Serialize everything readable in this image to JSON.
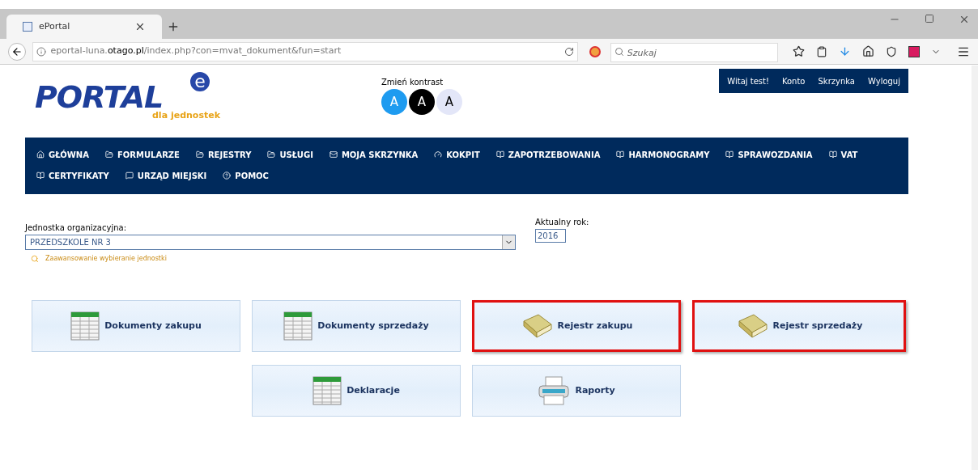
{
  "browser": {
    "tab_title": "ePortal",
    "url_prefix": "eportal-luna.",
    "url_domain": "otago.pl",
    "url_path": "/index.php?con=mvat_dokument&fun=start",
    "search_placeholder": "Szukaj"
  },
  "logo": {
    "text": "PORTAL",
    "badge": "e",
    "subtitle": "dla jednostek"
  },
  "contrast": {
    "label": "Zmień kontrast",
    "options": [
      {
        "text": "A",
        "kind": "blue"
      },
      {
        "text": "A",
        "kind": "dark"
      },
      {
        "text": "A",
        "kind": "light"
      }
    ]
  },
  "user_menu": [
    "Witaj test!",
    "Konto",
    "Skrzynka",
    "Wyloguj"
  ],
  "nav": [
    {
      "label": "GŁÓWNA",
      "kind": "home"
    },
    {
      "label": "FORMULARZE",
      "kind": "folder"
    },
    {
      "label": "REJESTRY",
      "kind": "folder"
    },
    {
      "label": "USŁUGI",
      "kind": "folder"
    },
    {
      "label": "MOJA SKRZYNKA",
      "kind": "mail"
    },
    {
      "label": "KOKPIT",
      "kind": "gauge"
    },
    {
      "label": "ZAPOTRZEBOWANIA",
      "kind": "book"
    },
    {
      "label": "HARMONOGRAMY",
      "kind": "book"
    },
    {
      "label": "SPRAWOZDANIA",
      "kind": "book"
    },
    {
      "label": "VAT",
      "kind": "book"
    },
    {
      "label": "CERTYFIKATY",
      "kind": "book"
    },
    {
      "label": "URZĄD MIEJSKI",
      "kind": "comment"
    },
    {
      "label": "POMOC",
      "kind": "help"
    }
  ],
  "unit": {
    "label": "Jednostka organizacyjna:",
    "value": "PRZEDSZKOLE NR 3",
    "advanced_link": "Zaawansowanie wybieranie jednostki"
  },
  "year": {
    "label": "Aktualny rok:",
    "value": "2016"
  },
  "tiles": [
    {
      "label": "Dokumenty zakupu",
      "kind": "table",
      "highlighted": false
    },
    {
      "label": "Dokumenty sprzedaży",
      "kind": "table",
      "highlighted": false
    },
    {
      "label": "Rejestr zakupu",
      "kind": "book",
      "highlighted": true
    },
    {
      "label": "Rejestr sprzedaży",
      "kind": "book",
      "highlighted": true
    },
    {
      "label": "Deklaracje",
      "kind": "table",
      "highlighted": false
    },
    {
      "label": "Raporty",
      "kind": "printer",
      "highlighted": false
    }
  ]
}
